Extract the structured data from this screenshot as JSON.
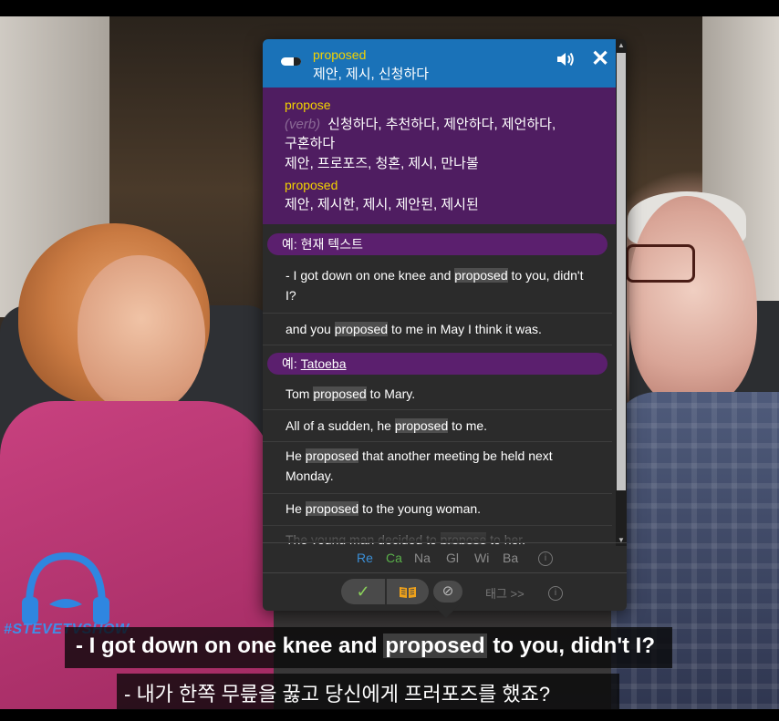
{
  "popup": {
    "header": {
      "word": "proposed",
      "translation": "제안, 제시, 신청하다"
    },
    "dictionary": {
      "entries": [
        {
          "word": "propose",
          "pos": "(verb)",
          "meanings": "신청하다, 추천하다, 제안하다, 제언하다, 구혼하다",
          "more": "제안, 프로포즈, 청혼, 제시, 만나볼"
        },
        {
          "word": "proposed",
          "meanings": "제안, 제시한, 제시, 제안된, 제시된"
        }
      ]
    },
    "sections": {
      "current_text": {
        "label": "예: 현재 텍스트"
      },
      "tatoeba": {
        "prefix": "예: ",
        "link": "Tatoeba"
      }
    },
    "current_examples": [
      {
        "before": "- I got down on one knee and ",
        "hl": "proposed",
        "after": " to you, didn't I?"
      },
      {
        "before": "and you ",
        "hl": "proposed",
        "after": " to me in May I think it was."
      }
    ],
    "tatoeba_examples": [
      {
        "before": "Tom ",
        "hl": "proposed",
        "after": " to Mary."
      },
      {
        "before": "All of a sudden, he ",
        "hl": "proposed",
        "after": " to me."
      },
      {
        "before": "He ",
        "hl": "proposed",
        "after": " that another meeting be held next Monday."
      },
      {
        "before": "He ",
        "hl": "proposed",
        "after": " to the young woman."
      },
      {
        "before": "The young man decided to ",
        "hl": "propose",
        "after": " to her."
      }
    ],
    "sources": [
      "Re",
      "Ca",
      "Na",
      "Gl",
      "Wi",
      "Ba"
    ],
    "source_colors": {
      "Re": "#3b8fd6",
      "Ca": "#5ab04a",
      "Na": "#8c8c8c",
      "Gl": "#8c8c8c",
      "Wi": "#8c8c8c",
      "Ba": "#8c8c8c"
    },
    "tag_label": "태그 >>",
    "info_glyph": "i"
  },
  "overlay": {
    "logo_text": "#STEVETVSHOW"
  },
  "subtitles": {
    "line1": {
      "before": "- I got down on one knee and ",
      "word": "proposed",
      "after": " to you, didn't I?"
    },
    "line2": "- 내가 한쪽 무릎을 꿇고 당신에게 프러포즈를 했죠?"
  }
}
